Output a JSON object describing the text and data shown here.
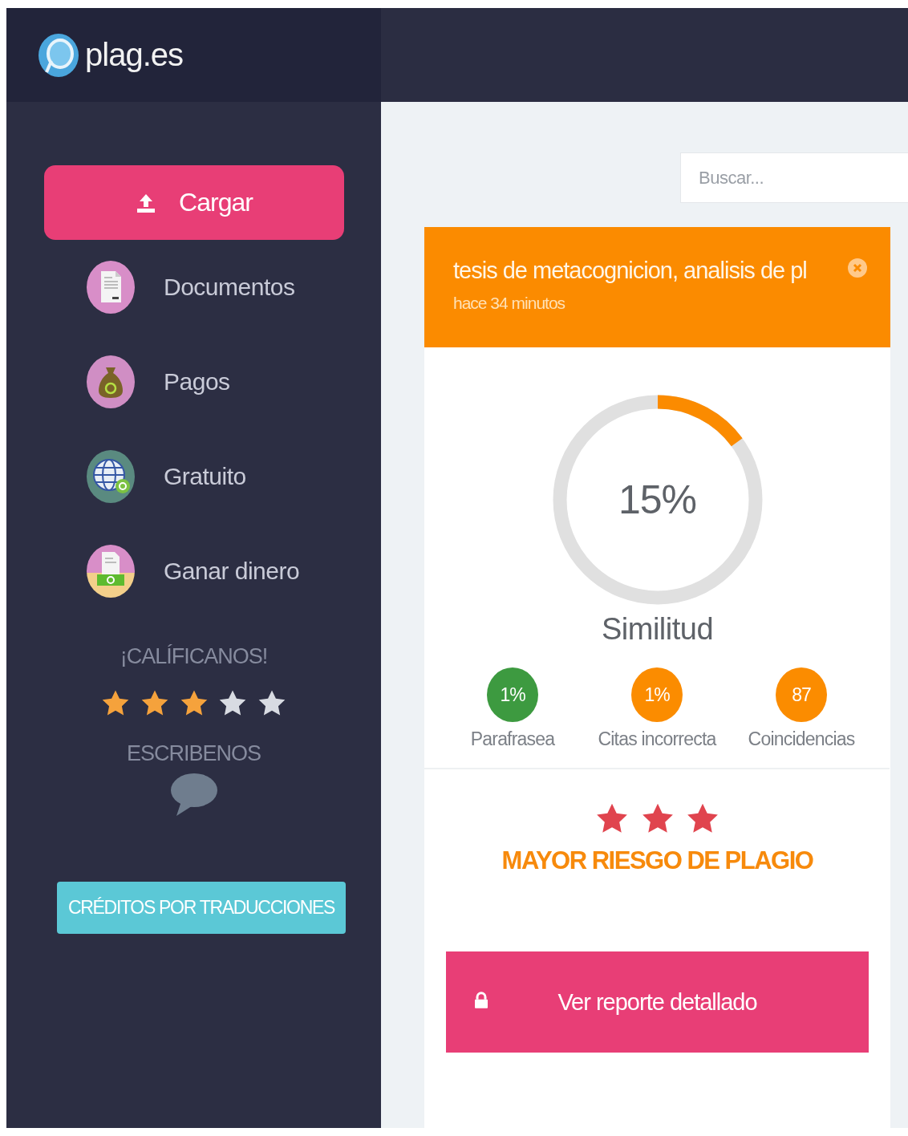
{
  "brand": {
    "name": "plag.es"
  },
  "sidebar": {
    "upload_button": "Cargar",
    "nav_items": [
      {
        "label": "Documentos",
        "kind": "document"
      },
      {
        "label": "Pagos",
        "kind": "moneybag"
      },
      {
        "label": "Gratuito",
        "kind": "globe"
      },
      {
        "label": "Ganar dinero",
        "kind": "earn"
      }
    ],
    "rating": {
      "heading": "¡CALÍFICANOS!",
      "stars": 3
    },
    "contact": {
      "heading": "ESCRIBENOS"
    },
    "credits_button": "CRÉDITOS POR TRADUCCIONES"
  },
  "search": {
    "placeholder": "Buscar..."
  },
  "document": {
    "title": "tesis de metacognicion, analisis de pl",
    "time": "hace 34 minutos",
    "similarity": {
      "level": 0.15,
      "value": "15%",
      "label": "Similitud"
    },
    "stats": [
      {
        "value": "1%",
        "label": "Parafrasea",
        "color": "#3d9a40"
      },
      {
        "value": "1%",
        "label": "Citas incorrecta",
        "color": "#fb8c00"
      },
      {
        "value": "87",
        "label": "Coincidencias",
        "color": "#fb8c00"
      }
    ],
    "risk": {
      "stars": 3,
      "label": "MAYOR RIESGO DE PLAGIO"
    },
    "report_button": "Ver reporte detallado"
  }
}
